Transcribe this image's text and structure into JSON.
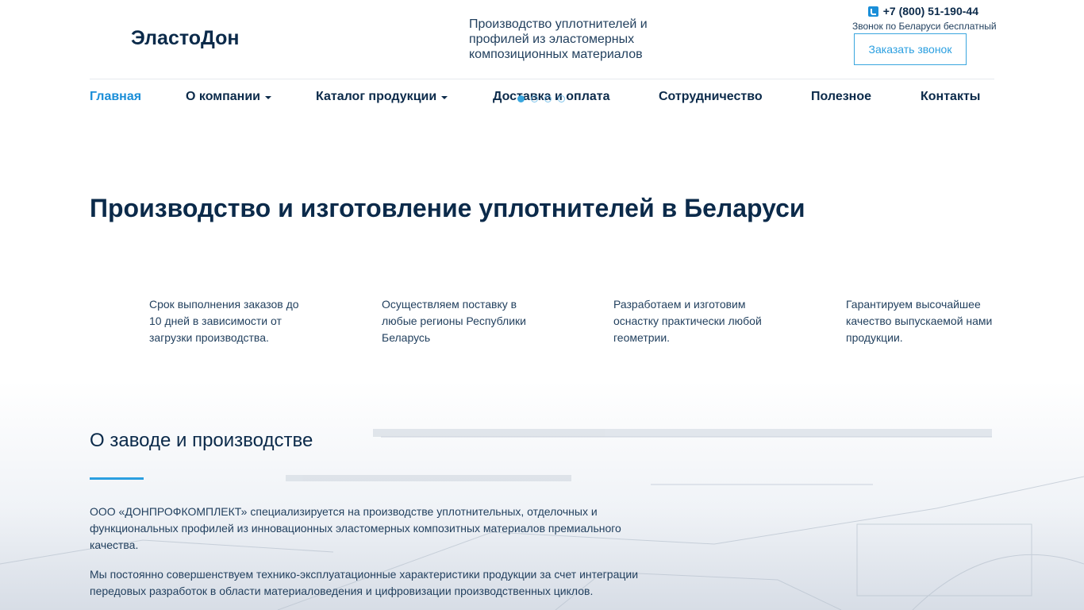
{
  "header": {
    "logo": "ЭластоДон",
    "tagline": "Производство уплотнителей и профилей из эластомерных композиционных материалов",
    "phone": "+7 (800) 51-190-44",
    "phone_note": "Звонок по Беларуси бесплатный",
    "callback_label": "Заказать звонок"
  },
  "nav": {
    "items": [
      {
        "label": "Главная",
        "active": true
      },
      {
        "label": "О компании",
        "dropdown": true
      },
      {
        "label": "Каталог продукции",
        "dropdown": true
      },
      {
        "label": "Доставка и оплата"
      },
      {
        "label": "Сотрудничество"
      },
      {
        "label": "Полезное"
      },
      {
        "label": "Контакты"
      }
    ]
  },
  "hero": {
    "title": "Производство и изготовление уплотнителей в Беларуси"
  },
  "features": [
    {
      "text": "Срок выполнения заказов до 10 дней в зависимости от загрузки производства."
    },
    {
      "text": "Осуществляем поставку в любые регионы Республики Беларусь"
    },
    {
      "text": "Разработаем и изготовим оснастку практически любой геометрии."
    },
    {
      "text": "Гарантируем высочайшее качество выпускаемой нами продукции."
    }
  ],
  "about": {
    "title": "О заводе и производстве",
    "paragraphs": [
      "ООО «ДОНПРОФКОМПЛЕКТ» специализируется на производстве уплотнительных, отделочных и функциональных профилей из инновационных эластомерных композитных материалов премиального качества.",
      "Мы постоянно совершенствуем технико-эксплуатационные характеристики продукции за счет интеграции передовых разработок в области материаловедения и цифровизации производственных циклов."
    ]
  },
  "colors": {
    "accent": "#2b9fe0",
    "text_dark": "#0b2a4a"
  }
}
